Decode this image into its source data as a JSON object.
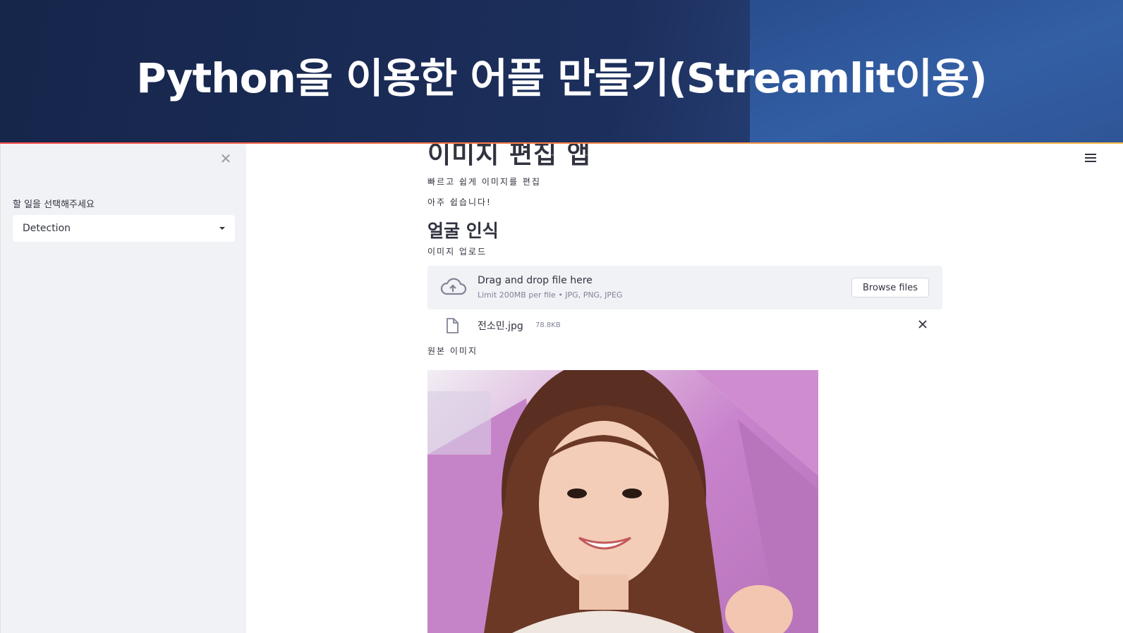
{
  "banner": {
    "title": "Python을 이용한 어플 만들기(Streamlit이용)"
  },
  "sidebar": {
    "select_label": "할 일을 선택해주세요",
    "selected_value": "Detection"
  },
  "main": {
    "title": "이미지 편집 앱",
    "line1": "빠르고 쉽게 이미지를 편집",
    "line2": "아주 쉽습니다!",
    "section_title": "얼굴 인식",
    "upload_label": "이미지 업로드",
    "uploader": {
      "drag_text": "Drag and drop file here",
      "limit_text": "Limit 200MB per file • JPG, PNG, JPEG",
      "browse_label": "Browse files"
    },
    "file": {
      "name": "전소민.jpg",
      "size": "78.8KB"
    },
    "original_label": "원본 이미지"
  },
  "colors": {
    "banner_dark": "#1c2f5c",
    "banner_light": "#3461a8",
    "sidebar_bg": "#f0f2f6",
    "text": "#31333f",
    "accent": "#ff4b4b"
  },
  "icons": [
    "close-icon",
    "caret-down-icon",
    "hamburger-menu-icon",
    "cloud-upload-icon",
    "file-icon",
    "remove-file-icon"
  ]
}
